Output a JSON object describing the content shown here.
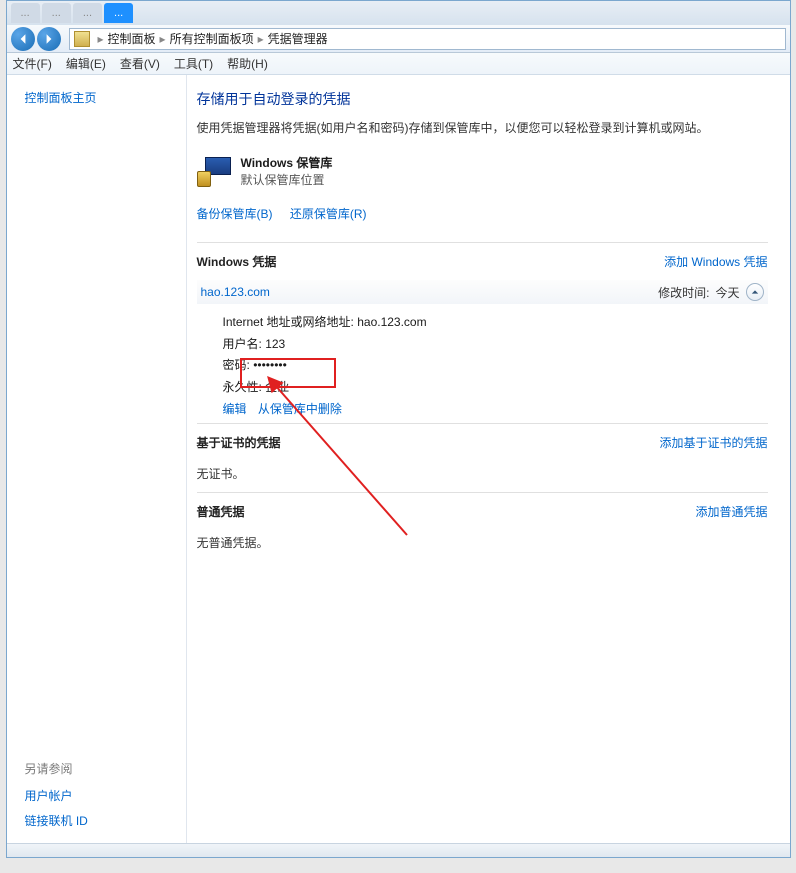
{
  "tabs": [
    {
      "label": "..."
    },
    {
      "label": "..."
    },
    {
      "label": "..."
    },
    {
      "label": "..."
    }
  ],
  "breadcrumb": {
    "root_icon": "folder-icon",
    "items": [
      "控制面板",
      "所有控制面板项",
      "凭据管理器"
    ]
  },
  "menu": {
    "file": "文件(F)",
    "edit": "编辑(E)",
    "view": "查看(V)",
    "tools": "工具(T)",
    "help": "帮助(H)"
  },
  "sidebar": {
    "home": "控制面板主页",
    "footer_heading": "另请参阅",
    "footer_links": [
      "用户帐户",
      "链接联机 ID"
    ]
  },
  "page": {
    "title": "存储用于自动登录的凭据",
    "desc": "使用凭据管理器将凭据(如用户名和密码)存储到保管库中，以便您可以轻松登录到计算机或网站。",
    "vault_title": "Windows 保管库",
    "vault_sub": "默认保管库位置",
    "backup_link": "备份保管库(B)",
    "restore_link": "还原保管库(R)"
  },
  "sections": {
    "windows": {
      "title": "Windows 凭据",
      "add_link": "添加 Windows 凭据",
      "credential": {
        "site": "hao.123.com",
        "modified_label": "修改时间:",
        "modified_value": "今天",
        "addr_label": "Internet 地址或网络地址:",
        "addr_value": "hao.123.com",
        "user_label": "用户名:",
        "user_value": "123",
        "pass_label": "密码:",
        "pass_value": "••••••••",
        "persist_label": "永久性:",
        "persist_value": "企业",
        "edit_link": "编辑",
        "remove_link": "从保管库中删除"
      }
    },
    "cert": {
      "title": "基于证书的凭据",
      "add_link": "添加基于证书的凭据",
      "empty": "无证书。"
    },
    "generic": {
      "title": "普通凭据",
      "add_link": "添加普通凭据",
      "empty": "无普通凭据。"
    }
  }
}
